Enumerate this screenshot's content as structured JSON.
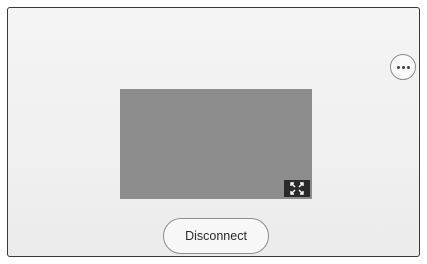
{
  "toolbar": {
    "more_icon": "more-options-icon"
  },
  "preview": {
    "background_color": "#8d8d8d",
    "fullscreen_icon": "expand-fullscreen-icon"
  },
  "actions": {
    "disconnect_label": "Disconnect"
  }
}
